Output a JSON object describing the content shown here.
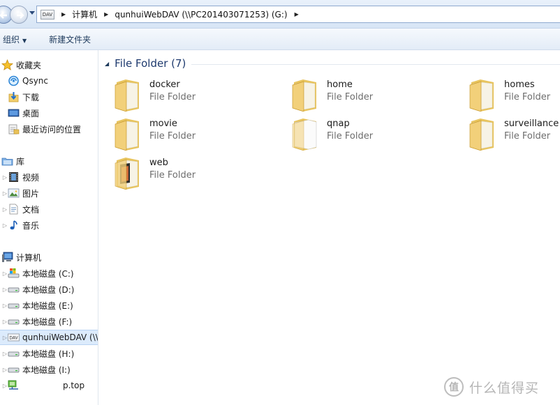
{
  "address_bar": {
    "location_icon": "dav-drive-icon",
    "location_icon_text": "DAV",
    "crumbs": [
      "计算机",
      "qunhuiWebDAV (\\\\PC201403071253) (G:)"
    ]
  },
  "toolbar": {
    "organize_label": "组织",
    "new_folder_label": "新建文件夹"
  },
  "sidebar": {
    "favorites": {
      "label": "收藏夹",
      "items": [
        {
          "label": "Qsync",
          "icon": "qsync-icon"
        },
        {
          "label": "下载",
          "icon": "downloads-icon"
        },
        {
          "label": "桌面",
          "icon": "desktop-icon"
        },
        {
          "label": "最近访问的位置",
          "icon": "recent-places-icon"
        }
      ]
    },
    "libraries": {
      "label": "库",
      "items": [
        {
          "label": "视频",
          "icon": "videos-icon"
        },
        {
          "label": "图片",
          "icon": "pictures-icon"
        },
        {
          "label": "文档",
          "icon": "documents-icon"
        },
        {
          "label": "音乐",
          "icon": "music-icon"
        }
      ]
    },
    "computer": {
      "label": "计算机",
      "items": [
        {
          "label": "本地磁盘 (C:)",
          "icon": "system-drive-icon"
        },
        {
          "label": "本地磁盘 (D:)",
          "icon": "drive-icon"
        },
        {
          "label": "本地磁盘 (E:)",
          "icon": "drive-icon"
        },
        {
          "label": "本地磁盘 (F:)",
          "icon": "drive-icon"
        },
        {
          "label": "qunhuiWebDAV (\\\\",
          "icon": "dav-drive-icon",
          "selected": true
        },
        {
          "label": "本地磁盘 (H:)",
          "icon": "drive-icon"
        },
        {
          "label": "本地磁盘 (I:)",
          "icon": "drive-icon"
        }
      ]
    },
    "network_item": {
      "label": "p.top",
      "icon": "network-drive-icon"
    }
  },
  "content": {
    "group_title": "File Folder (7)",
    "items": [
      {
        "name": "docker",
        "type": "File Folder"
      },
      {
        "name": "home",
        "type": "File Folder"
      },
      {
        "name": "homes",
        "type": "File Folder"
      },
      {
        "name": "movie",
        "type": "File Folder"
      },
      {
        "name": "qnap",
        "type": "File Folder"
      },
      {
        "name": "surveillance",
        "type": "File Folder"
      },
      {
        "name": "web",
        "type": "File Folder"
      }
    ]
  },
  "watermark": {
    "logo_text": "值",
    "text": "什么值得买"
  },
  "colors": {
    "toolbar_bg": "#e3ecf7",
    "selection_bg": "#dcebfc",
    "group_title": "#1e3a6e",
    "folder_yellow": "#f2d07a"
  }
}
